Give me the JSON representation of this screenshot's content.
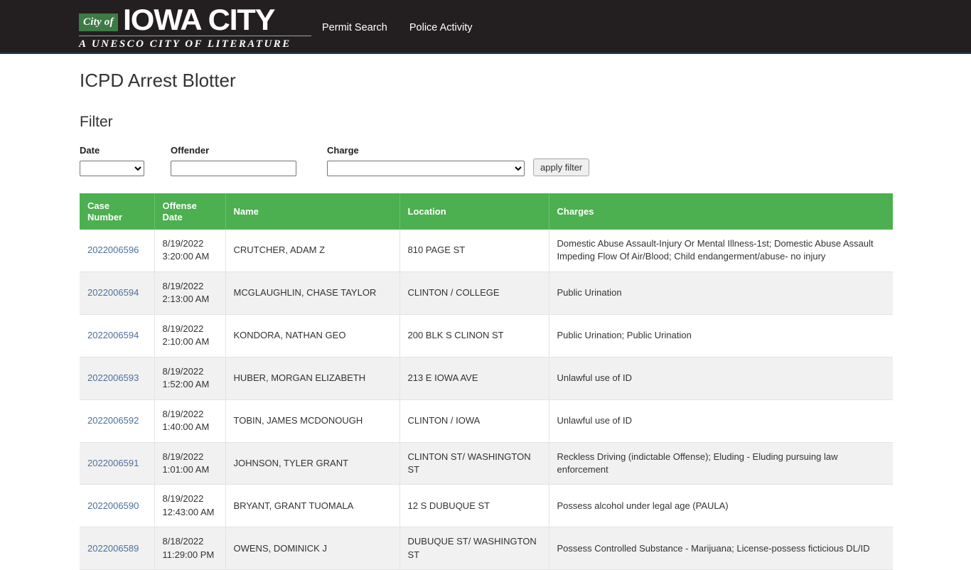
{
  "header": {
    "logo": {
      "badge": "City of",
      "main": "IOWA CITY",
      "tagline": "A UNESCO CITY OF LITERATURE"
    },
    "nav": [
      {
        "label": "Permit Search"
      },
      {
        "label": "Police Activity"
      }
    ],
    "colors": {
      "background": "#231f20",
      "badge_green": "#3d7a45",
      "bottom_border": "#1c3f63"
    }
  },
  "page": {
    "title": "ICPD Arrest Blotter",
    "filter_heading": "Filter"
  },
  "filter": {
    "date": {
      "label": "Date",
      "value": "",
      "options": [
        ""
      ]
    },
    "offender": {
      "label": "Offender",
      "value": "",
      "placeholder": ""
    },
    "charge": {
      "label": "Charge",
      "value": "",
      "options": [
        ""
      ]
    },
    "apply_button": "apply filter"
  },
  "table": {
    "accent_color": "#4caf50",
    "link_color": "#4f6f9a",
    "columns": [
      "Case Number",
      "Offense Date",
      "Name",
      "Location",
      "Charges"
    ],
    "rows": [
      {
        "case_number": "2022006596",
        "offense_date": "8/19/2022\n3:20:00 AM",
        "name": "CRUTCHER, ADAM Z",
        "location": "810 PAGE ST",
        "charges": "Domestic Abuse Assault-Injury Or Mental Illness-1st; Domestic Abuse Assault Impeding Flow Of Air/Blood; Child endangerment/abuse- no injury"
      },
      {
        "case_number": "2022006594",
        "offense_date": "8/19/2022\n2:13:00 AM",
        "name": "MCGLAUGHLIN, CHASE TAYLOR",
        "location": "CLINTON / COLLEGE",
        "charges": "Public Urination"
      },
      {
        "case_number": "2022006594",
        "offense_date": "8/19/2022\n2:10:00 AM",
        "name": "KONDORA, NATHAN GEO",
        "location": "200 BLK S CLINON ST",
        "charges": "Public Urination; Public Urination"
      },
      {
        "case_number": "2022006593",
        "offense_date": "8/19/2022\n1:52:00 AM",
        "name": "HUBER, MORGAN ELIZABETH",
        "location": "213 E IOWA AVE",
        "charges": "Unlawful use of ID"
      },
      {
        "case_number": "2022006592",
        "offense_date": "8/19/2022\n1:40:00 AM",
        "name": "TOBIN, JAMES MCDONOUGH",
        "location": "CLINTON / IOWA",
        "charges": "Unlawful use of ID"
      },
      {
        "case_number": "2022006591",
        "offense_date": "8/19/2022\n1:01:00 AM",
        "name": "JOHNSON, TYLER GRANT",
        "location": "CLINTON ST/ WASHINGTON ST",
        "charges": "Reckless Driving (indictable Offense); Eluding - Eluding pursuing law enforcement"
      },
      {
        "case_number": "2022006590",
        "offense_date": "8/19/2022\n12:43:00 AM",
        "name": "BRYANT, GRANT TUOMALA",
        "location": "12 S DUBUQUE ST",
        "charges": "Possess alcohol under legal age (PAULA)"
      },
      {
        "case_number": "2022006589",
        "offense_date": "8/18/2022\n11:29:00 PM",
        "name": "OWENS, DOMINICK J",
        "location": "DUBUQUE ST/ WASHINGTON ST",
        "charges": "Possess Controlled Substance - Marijuana; License-possess ficticious DL/ID"
      }
    ]
  }
}
